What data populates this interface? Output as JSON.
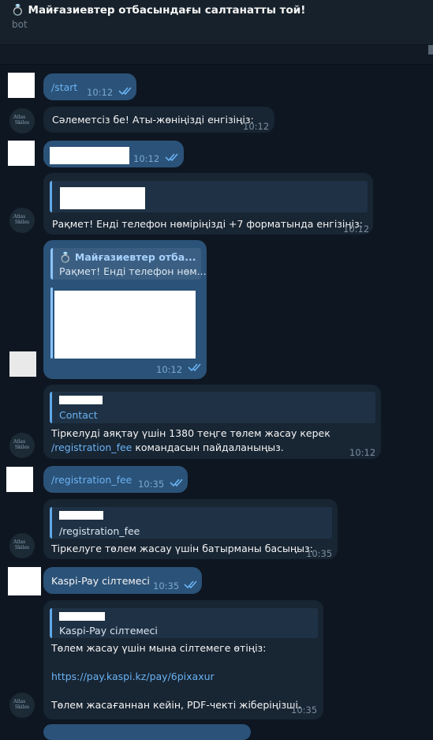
{
  "header": {
    "title": "💍 Майғазиевтер отбасындағы салтанатты той!",
    "subtitle": "bot"
  },
  "colors": {
    "background": "#0e1621",
    "incoming_bubble": "#182533",
    "outgoing_bubble": "#2b5278",
    "link": "#6ab3f3"
  },
  "messages": [
    {
      "text": "/start",
      "time": "10:12"
    },
    {
      "text": "Сәлеметсіз бе! Аты-жөніңізді енгізіңіз:",
      "time": "10:12"
    },
    {
      "time": "10:12"
    },
    {
      "text": "Рақмет! Енді телефон нөміріңізді +7 форматында енгізіңіз:",
      "time": "10:12"
    },
    {
      "quote_name": "💍 Майғазиевтер отба...",
      "quote_text": "Рақмет! Енді телефон нөм...",
      "time": "10:12"
    },
    {
      "quote_title": "Contact",
      "text_line1": "Тіркелуді аяқтау үшін 1380 теңге төлем жасау керек",
      "link": "/registration_fee",
      "text_line2": " командасын пайдаланыңыз.",
      "time": "10:12"
    },
    {
      "text": "/registration_fee",
      "time": "10:35"
    },
    {
      "quote_text": "/registration_fee",
      "text": "Тіркелуге төлем жасау үшін батырманы басыңыз:",
      "time": "10:35"
    },
    {
      "text": "Kaspi-Pay сілтемесі",
      "time": "10:35"
    },
    {
      "quote_text": "Kaspi-Pay сілтемесі",
      "line1": "Төлем жасау үшін мына сілтемеге өтіңіз:",
      "link": "https://pay.kaspi.kz/pay/6pixaxur",
      "line2": "Төлем жасағаннан кейін, PDF-чекті жіберіңізші.",
      "time": "10:35"
    }
  ],
  "bot_avatar_text": "Atlas\nSkiles"
}
